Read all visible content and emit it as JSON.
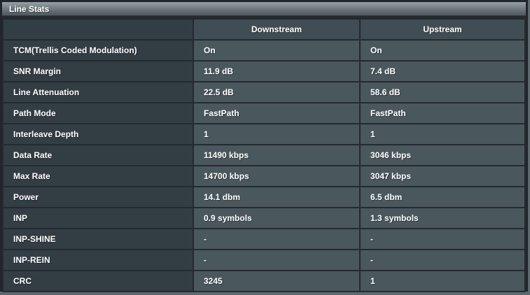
{
  "panel": {
    "title": "Line Stats"
  },
  "table": {
    "columns": [
      "",
      "Downstream",
      "Upstream"
    ],
    "rows": [
      {
        "label": "TCM(Trellis Coded Modulation)",
        "downstream": "On",
        "upstream": "On"
      },
      {
        "label": "SNR Margin",
        "downstream": "11.9 dB",
        "upstream": "7.4 dB"
      },
      {
        "label": "Line Attenuation",
        "downstream": "22.5 dB",
        "upstream": "58.6 dB"
      },
      {
        "label": "Path Mode",
        "downstream": "FastPath",
        "upstream": "FastPath"
      },
      {
        "label": "Interleave Depth",
        "downstream": "1",
        "upstream": "1"
      },
      {
        "label": "Data Rate",
        "downstream": "11490 kbps",
        "upstream": "3046 kbps"
      },
      {
        "label": "Max Rate",
        "downstream": "14700 kbps",
        "upstream": "3047 kbps"
      },
      {
        "label": "Power",
        "downstream": "14.1 dbm",
        "upstream": "6.5 dbm"
      },
      {
        "label": "INP",
        "downstream": "0.9 symbols",
        "upstream": "1.3 symbols"
      },
      {
        "label": "INP-SHINE",
        "downstream": "-",
        "upstream": "-"
      },
      {
        "label": "INP-REIN",
        "downstream": "-",
        "upstream": "-"
      },
      {
        "label": "CRC",
        "downstream": "3245",
        "upstream": "1"
      }
    ]
  },
  "colors": {
    "page_background": "#5d696e",
    "panel_border": "#20262b",
    "label_cell": "#333d44",
    "value_cell": "#4a575d",
    "header_cell": "#414d54",
    "title_gradient_top": "#97a1a7",
    "title_gradient_bottom": "#4e585f",
    "text": "#ffffff"
  }
}
